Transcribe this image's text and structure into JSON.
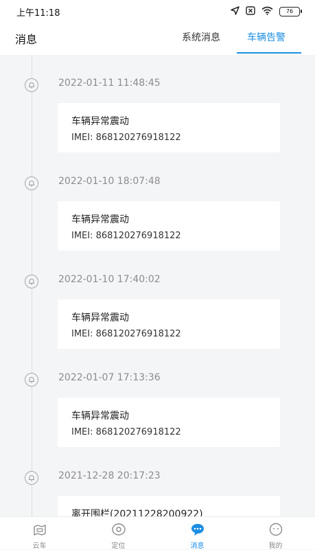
{
  "status_bar": {
    "time": "上午11:18",
    "battery": "76"
  },
  "header": {
    "title": "消息",
    "tabs": [
      {
        "label": "系统消息",
        "active": false
      },
      {
        "label": "车辆告警",
        "active": true
      }
    ]
  },
  "alerts": [
    {
      "time": "2022-01-11 11:48:45",
      "title": "车辆异常震动",
      "imei": "IMEI: 868120276918122"
    },
    {
      "time": "2022-01-10 18:07:48",
      "title": "车辆异常震动",
      "imei": "IMEI: 868120276918122"
    },
    {
      "time": "2022-01-10 17:40:02",
      "title": "车辆异常震动",
      "imei": "IMEI: 868120276918122"
    },
    {
      "time": "2022-01-07 17:13:36",
      "title": "车辆异常震动",
      "imei": "IMEI: 868120276918122"
    },
    {
      "time": "2021-12-28 20:17:23",
      "title": "离开围栏(20211228200922)",
      "imei": ""
    }
  ],
  "bottom_nav": [
    {
      "label": "云车",
      "icon": "car-map-icon",
      "active": false
    },
    {
      "label": "定位",
      "icon": "location-eye-icon",
      "active": false
    },
    {
      "label": "消息",
      "icon": "message-bubble-icon",
      "active": true
    },
    {
      "label": "我的",
      "icon": "profile-face-icon",
      "active": false
    }
  ],
  "colors": {
    "accent": "#1b8ee3",
    "background": "#f4f5f7"
  }
}
